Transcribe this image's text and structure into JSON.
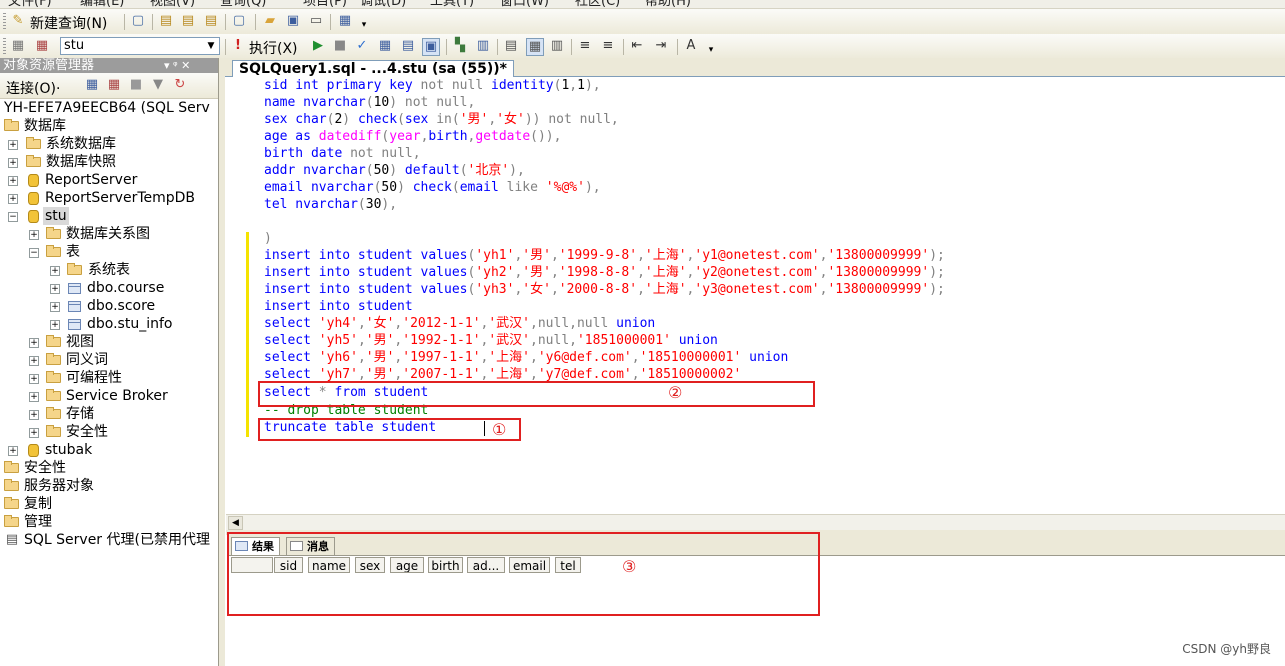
{
  "menu": [
    "文件(F)",
    "编辑(E)",
    "视图(V)",
    "查询(Q)",
    "项目(P)",
    "调试(D)",
    "工具(T)",
    "窗口(W)",
    "社区(C)",
    "帮助(H)"
  ],
  "toolbar1": {
    "new_query": "新建查询(N)"
  },
  "toolbar2": {
    "database": "stu",
    "execute": "执行(X)"
  },
  "object_explorer": {
    "title": "对象资源管理器",
    "title_controls": "▾ ᵠ ✕",
    "connect": "连接(O)·",
    "server": "YH-EFE7A9EECB64 (SQL Serv",
    "nodes": [
      "数据库",
      "系统数据库",
      "数据库快照",
      "ReportServer",
      "ReportServerTempDB",
      "stu",
      "数据库关系图",
      "表",
      "系统表",
      "dbo.course",
      "dbo.score",
      "dbo.stu_info",
      "视图",
      "同义词",
      "可编程性",
      "Service Broker",
      "存储",
      "安全性",
      "stubak",
      "安全性",
      "服务器对象",
      "复制",
      "管理",
      "SQL Server 代理(已禁用代理"
    ]
  },
  "editor": {
    "tab_title": "SQLQuery1.sql - ...4.stu (sa (55))*",
    "lines": [
      "sid int primary key not null identity(1,1),",
      "name nvarchar(10) not null,",
      "sex char(2) check(sex in('男','女')) not null,",
      "age as datediff(year,birth,getdate()),",
      "birth date not null,",
      "addr nvarchar(50) default('北京'),",
      "email nvarchar(50) check(email like '%@%'),",
      "tel nvarchar(30),",
      "",
      ")",
      "insert into student values('yh1','男','1999-9-8','上海','y1@onetest.com','13800009999');",
      "insert into student values('yh2','男','1998-8-8','上海','y2@onetest.com','13800009999');",
      "insert into student values('yh3','女','2000-8-8','上海','y3@onetest.com','13800009999');",
      "insert into student",
      "select 'yh4','女','2012-1-1','武汉',null,null union",
      "select 'yh5','男','1992-1-1','武汉',null,'1851000001' union",
      "select 'yh6','男','1997-1-1','上海','y6@def.com','18510000001' union",
      "select 'yh7','男','2007-1-1','上海','y7@def.com','18510000002'",
      "select * from student",
      "-- drop table student",
      "truncate table student"
    ]
  },
  "results": {
    "tabs": [
      "结果",
      "消息"
    ],
    "columns": [
      "sid",
      "name",
      "sex",
      "age",
      "birth",
      "ad...",
      "email",
      "tel"
    ]
  },
  "annotations": {
    "box1": "①",
    "box2": "②",
    "box3": "③"
  },
  "watermark": "CSDN @yh野良",
  "colors": {
    "keyword": "#0000ff",
    "string": "#ff0000",
    "annotation": "#e02020",
    "comment": "#008000"
  }
}
